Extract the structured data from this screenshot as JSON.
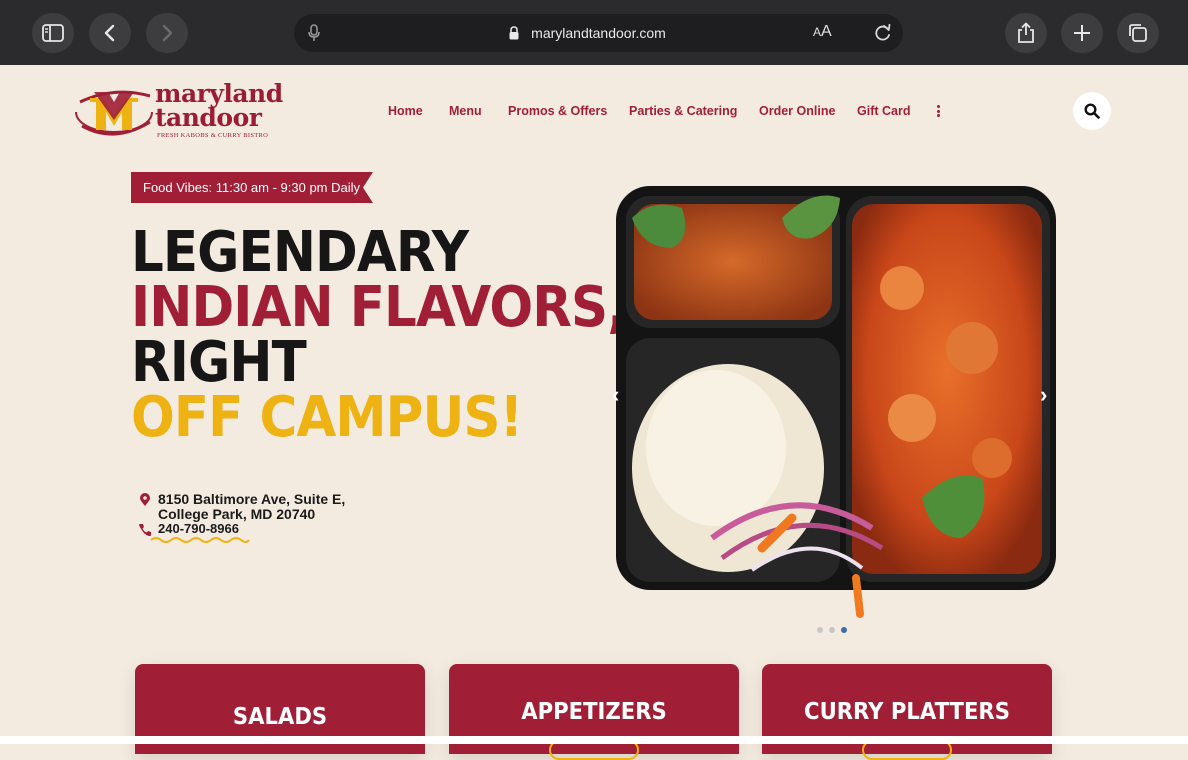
{
  "browser": {
    "url": "marylandtandoor.com",
    "reader_label_small": "A",
    "reader_label_large": "A"
  },
  "site": {
    "logo_line1": "maryland",
    "logo_line2": "tandoor",
    "logo_tagline": "FRESH KABOBS & CURRY BISTRO",
    "nav": [
      "Home",
      "Menu",
      "Promos & Offers",
      "Parties & Catering",
      "Order Online",
      "Gift Card"
    ]
  },
  "hero": {
    "ribbon": "Food Vibes: 11:30 am - 9:30 pm Daily",
    "headline": [
      "LEGENDARY",
      "INDIAN FLAVORS,",
      "RIGHT",
      "OFF CAMPUS!"
    ],
    "address_line1": "8150 Baltimore Ave, Suite E,",
    "address_line2": "College Park, MD 20740",
    "phone": "240-790-8966",
    "prev_arrow": "‹",
    "next_arrow": "›",
    "slide_count": 3,
    "active_slide": 3
  },
  "categories": [
    "SALADS",
    "APPETIZERS",
    "CURRY PLATTERS"
  ],
  "colors": {
    "brand_red": "#a01f36",
    "brand_yellow": "#eeb212",
    "page_bg": "#f4ebe0"
  }
}
